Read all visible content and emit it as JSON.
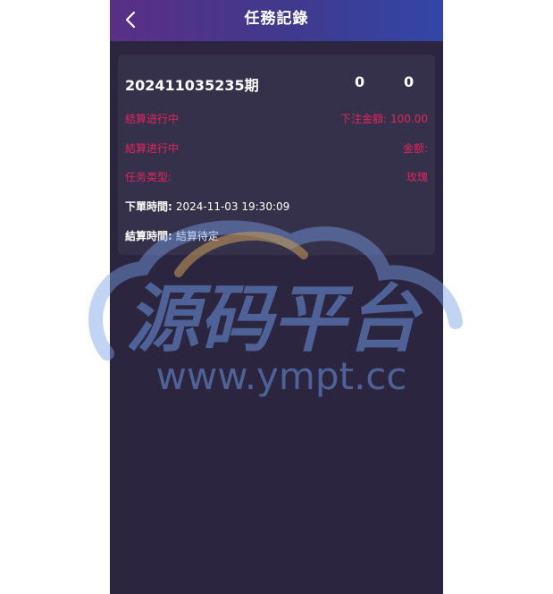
{
  "header": {
    "title": "任務記錄",
    "back_icon": "chevron-left-icon"
  },
  "record": {
    "period": "202411035235期",
    "num1": "0",
    "num2": "0",
    "status1": "結算进行中",
    "bet_amount_label": "下注金額:",
    "bet_amount_value": "100.00",
    "status2": "結算进行中",
    "amount_label": "金额:",
    "task_type_label": "任务类型:",
    "task_type_value": "玫瑰",
    "order_time_label": "下單時間:",
    "order_time_value": "2024-11-03 19:30:09",
    "settle_time_label": "結算時間:",
    "settle_time_value": "結算待定"
  },
  "watermark": {
    "brand": "源码平台",
    "url": "www.ympt.cc"
  },
  "colors": {
    "accent_red": "#e0245e",
    "background": "#2b253f",
    "card": "#36314a"
  }
}
